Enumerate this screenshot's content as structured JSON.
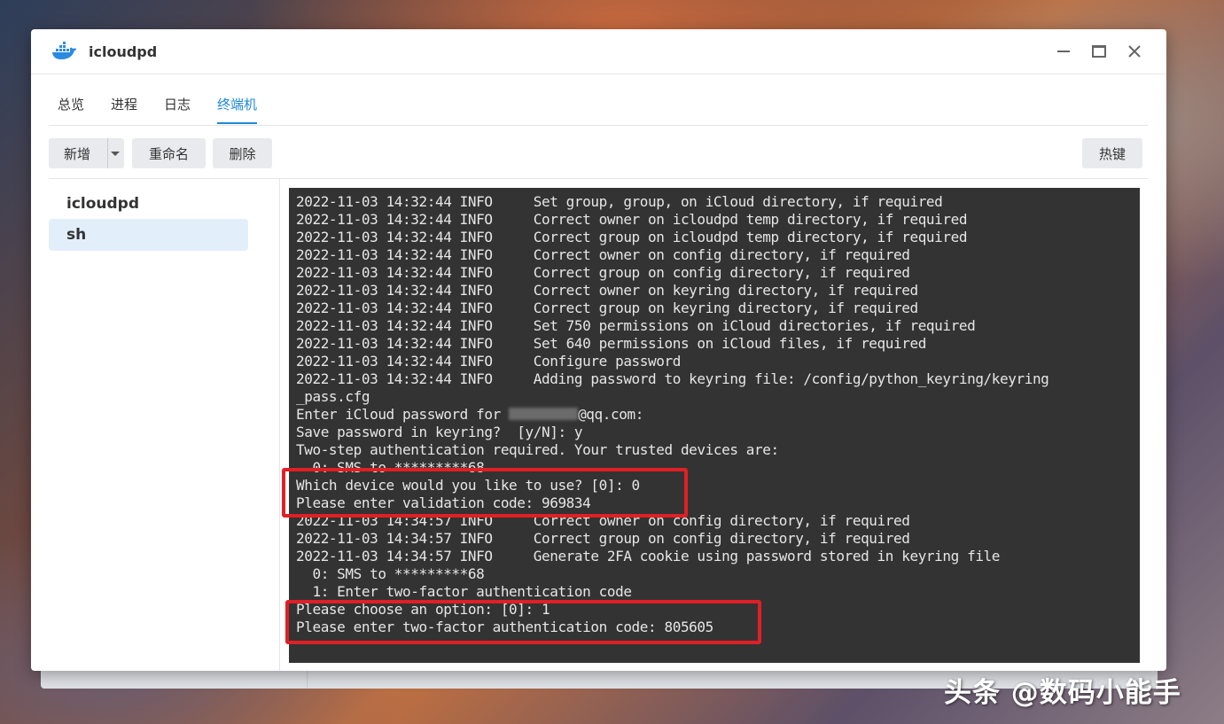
{
  "window": {
    "title": "icloudpd"
  },
  "tabs": [
    {
      "label": "总览"
    },
    {
      "label": "进程"
    },
    {
      "label": "日志"
    },
    {
      "label": "终端机",
      "active": true
    }
  ],
  "toolbar": {
    "add_label": "新增",
    "rename_label": "重命名",
    "delete_label": "删除",
    "hotkey_label": "热键"
  },
  "sidebar": {
    "items": [
      {
        "label": "icloudpd",
        "active": false
      },
      {
        "label": "sh",
        "active": true
      }
    ]
  },
  "terminal": {
    "lines": [
      "2022-11-03 14:32:44 INFO     Set group, group, on iCloud directory, if required",
      "2022-11-03 14:32:44 INFO     Correct owner on icloudpd temp directory, if required",
      "2022-11-03 14:32:44 INFO     Correct group on icloudpd temp directory, if required",
      "2022-11-03 14:32:44 INFO     Correct owner on config directory, if required",
      "2022-11-03 14:32:44 INFO     Correct group on config directory, if required",
      "2022-11-03 14:32:44 INFO     Correct owner on keyring directory, if required",
      "2022-11-03 14:32:44 INFO     Correct group on keyring directory, if required",
      "2022-11-03 14:32:44 INFO     Set 750 permissions on iCloud directories, if required",
      "2022-11-03 14:32:44 INFO     Set 640 permissions on iCloud files, if required",
      "2022-11-03 14:32:44 INFO     Configure password",
      "2022-11-03 14:32:44 INFO     Adding password to keyring file: /config/python_keyring/keyring",
      "_pass.cfg",
      "Enter iCloud password for ",
      "Save password in keyring?  [y/N]: y",
      "Two-step authentication required. Your trusted devices are:",
      "  0: SMS to *********68",
      "Which device would you like to use? [0]: 0",
      "Please enter validation code: 969834",
      "2022-11-03 14:34:57 INFO     Correct owner on config directory, if required",
      "2022-11-03 14:34:57 INFO     Correct group on config directory, if required",
      "2022-11-03 14:34:57 INFO     Generate 2FA cookie using password stored in keyring file",
      "  0: SMS to *********68",
      "  1: Enter two-factor authentication code",
      "Please choose an option: [0]: 1",
      "Please enter two-factor authentication code: 805605"
    ],
    "email_suffix": "@qq.com:"
  },
  "watermark": "头条 @数码小能手",
  "colors": {
    "accent": "#1e88d8",
    "terminal_bg": "#333333",
    "highlight": "#e01f26"
  }
}
